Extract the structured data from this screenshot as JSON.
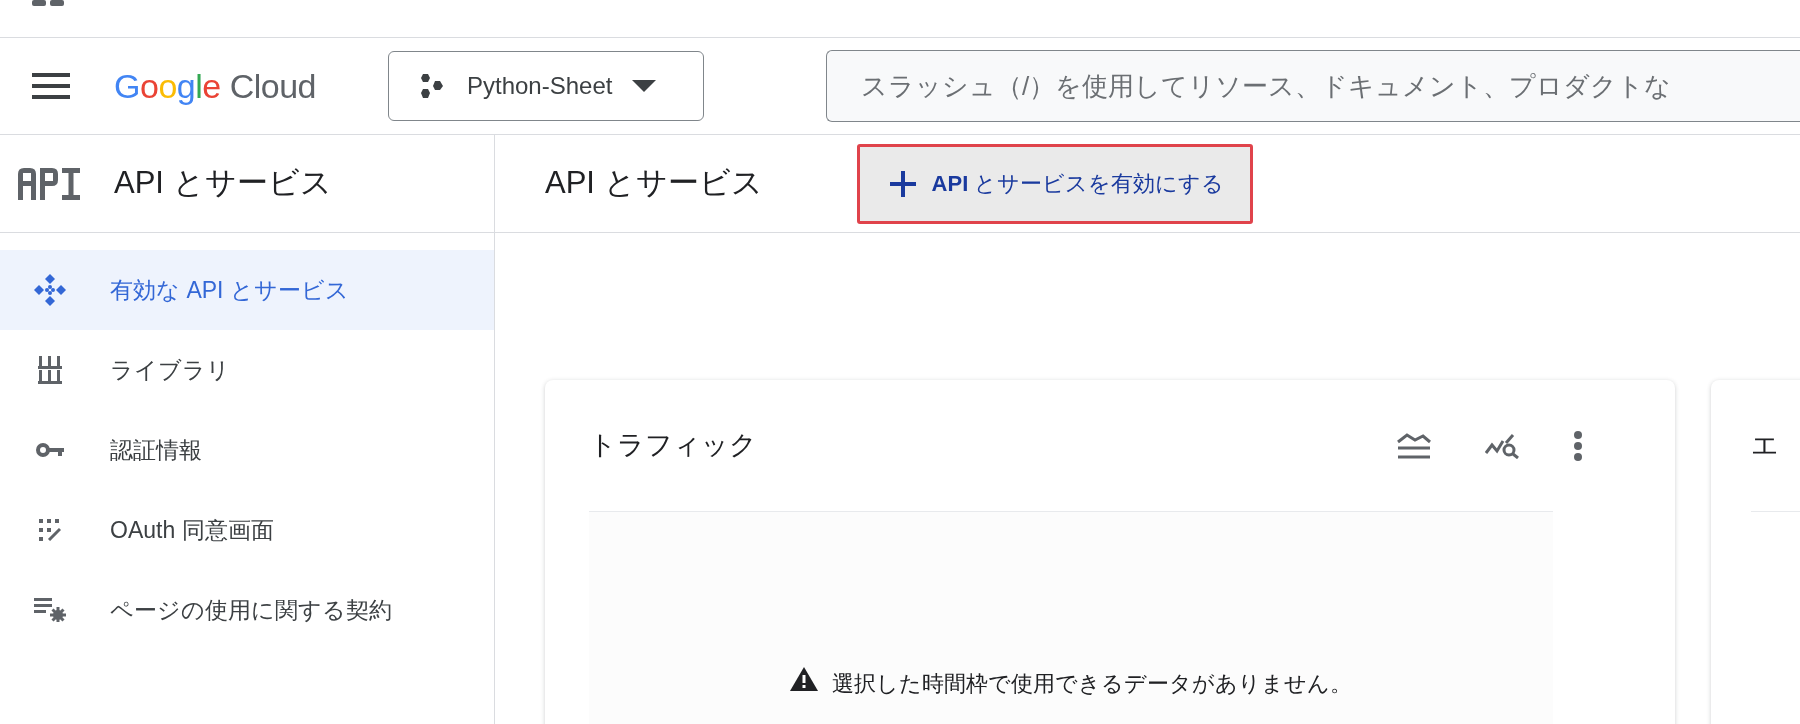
{
  "header": {
    "logo": {
      "brand": "Google",
      "product": "Cloud"
    },
    "project_selector": {
      "label": "Python-Sheet"
    },
    "search": {
      "placeholder": "スラッシュ（/）を使用してリソース、ドキュメント、プロダクトな"
    }
  },
  "sidebar": {
    "title": "API とサービス",
    "items": [
      {
        "label": "有効な API とサービス",
        "selected": true
      },
      {
        "label": "ライブラリ",
        "selected": false
      },
      {
        "label": "認証情報",
        "selected": false
      },
      {
        "label": "OAuth 同意画面",
        "selected": false
      },
      {
        "label": "ページの使用に関する契約",
        "selected": false
      }
    ]
  },
  "main": {
    "title": "API とサービス",
    "enable_button": {
      "label": "**API** とサービスを有効にする",
      "highlighted": true
    },
    "cards": [
      {
        "title": "トラフィック",
        "message": "選択した時間枠で使用できるデータがありません。"
      },
      {
        "title": "エ"
      }
    ]
  }
}
